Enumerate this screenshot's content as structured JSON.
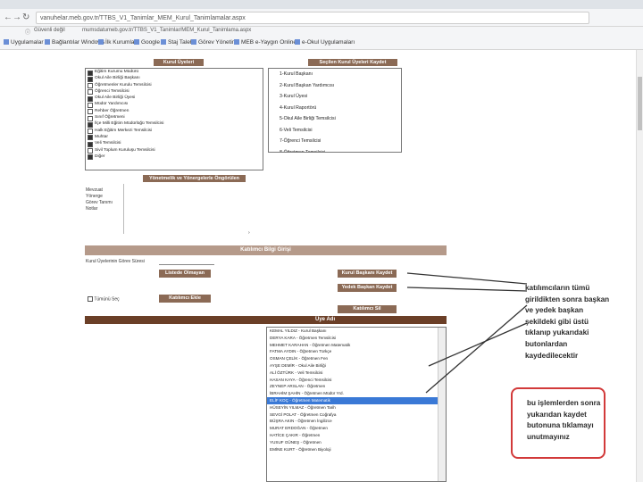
{
  "browser": {
    "url": "vanuhelar.meb.gov.tr/TTBS_V1_Tanimlar_MEM_Kurul_Tanimlamalar.aspx",
    "security": "Güvenli değil",
    "security_url": "mumsdatumeb.gov.tr/TTBS_V1_Tanimlar/MEM_Kurul_Tanimlama.aspx",
    "bookmarks": [
      "Uygulamalar",
      "Bağlantılar Windows",
      "İlk Kurumlar",
      "Google",
      "Staj Taleb",
      "Görev Yönetim",
      "MEB e-Yaygın Online",
      "e-Okul Uygulamaları"
    ]
  },
  "page": {
    "top_buttons": [
      "Kurul Üyeleri",
      "Seçilen Kurul Üyeleri Kaydet"
    ],
    "check_items": [
      {
        "label": "Eğitim Kurumu Müdürü",
        "checked": true
      },
      {
        "label": "Okul Aile Birliği Başkanı",
        "checked": true
      },
      {
        "label": "Öğretmenler Kurulu Temsilcisi",
        "checked": false
      },
      {
        "label": "Öğrenci Temsilcisi",
        "checked": false
      },
      {
        "label": "Okul Aile Birliği Üyesi",
        "checked": true
      },
      {
        "label": "Müdür Yardımcısı",
        "checked": false
      },
      {
        "label": "Rehber Öğretmen",
        "checked": false
      },
      {
        "label": "Sınıf Öğretmeni",
        "checked": false
      },
      {
        "label": "İlçe Milli Eğitim Müdürlüğü Temsilcisi",
        "checked": true
      },
      {
        "label": "Halk Eğitim Merkezi Temsilcisi",
        "checked": false
      },
      {
        "label": "Muhtar",
        "checked": true
      },
      {
        "label": "Veli Temsilcisi",
        "checked": true
      },
      {
        "label": "Sivil Toplum Kuruluşu Temsilcisi",
        "checked": false
      },
      {
        "label": "Diğer",
        "checked": true
      }
    ],
    "right_list": [
      "1-Kurul Başkanı",
      "2-Kurul Başkan Yardımcısı",
      "3-Kurul Üyesi",
      "4-Kurul Raportörü",
      "5-Okul Aile Birliği Temsilcisi",
      "6-Veli Temsilcisi",
      "7-Öğrenci Temsilcisi",
      "8-Öğretmen Temsilcisi",
      "9-Diğer"
    ],
    "list_button": "Yönetmelik ve Yönergelerle Öngörülen Görevler Ekle",
    "side_labels": [
      "Mevzuat",
      "Yönerge",
      "Görev Tanımı",
      "Notlar"
    ],
    "section_title": "Katılımcı Bilgi Girişi",
    "date_label": "Kurul Üyelerinin Görev Süresi",
    "btn_add_member": "Listede Olmayan Kaydet",
    "btn_save_president": "Kurul Başkanı Kaydet",
    "btn_vice": "Yedek Başkan Kaydet",
    "checkbox_all": "Tümünü Seç",
    "btn_add_participant": "Katılımcı Ekle",
    "btn_delete": "Katılımcı Sil",
    "list_header": "Üye Adı",
    "people": [
      "KEMAL YILDIZ - Kurul Başkanı",
      "DERYA KARA - Öğretmen Temsilcisi",
      "MEHMET KARAHAN - Öğretmen Matematik",
      "FATMA AYDIN - Öğretmen Türkçe",
      "OSMAN ÇELİK - Öğretmen Fen",
      "AYŞE DEMİR - Okul Aile Birliği",
      "ALİ ÖZTÜRK - Veli Temsilcisi",
      "HASAN KAYA - Öğrenci Temsilcisi",
      "ZEYNEP ARSLAN - Öğretmen",
      "İBRAHİM ŞAHİN - Öğretmen Müdür Yrd.",
      "ELİF KOÇ - Öğretmen Matematik",
      "HÜSEYİN YILMAZ - Öğretmen Tarih",
      "SEVGİ POLAT - Öğretmen Coğrafya",
      "BÜŞRA AKIN - Öğretmen İngilizce",
      "MURAT ERDOĞAN - Öğretmen",
      "HATİCE ÇAKIR - Öğretmen",
      "YUSUF GÜNEŞ - Öğretmen",
      "EMİNE KURT - Öğretmen Biyoloji"
    ],
    "selected_index": 10
  },
  "notes": {
    "note1": "katılımcıların tümü\ngirildikten sonra başkan\nve yedek başkan\nşekildeki gibi üstü\ntıklanıp yukarıdaki\nbutonlardan\nkaydedilecektir",
    "note2": "bu işlemlerden sonra\nyukarıdan kaydet\nbutonuna tıklamayı\nunutmayınız"
  }
}
